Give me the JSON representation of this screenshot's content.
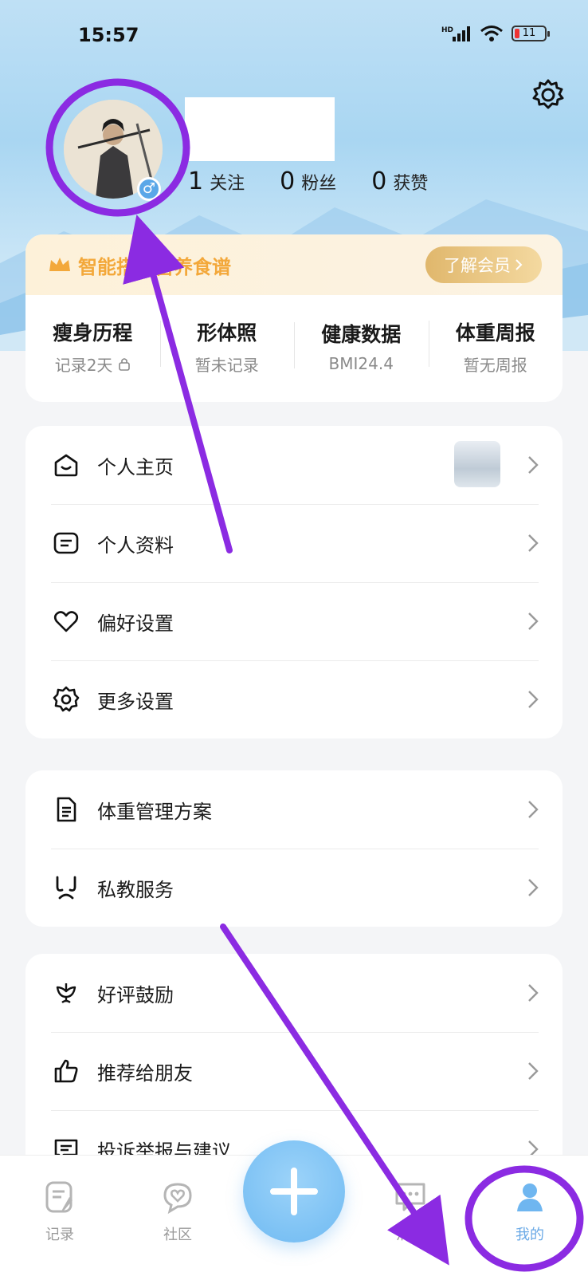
{
  "status_bar": {
    "time": "15:57",
    "network": "HD",
    "battery": "11"
  },
  "profile": {
    "stats": [
      {
        "num": "1",
        "label": "关注"
      },
      {
        "num": "0",
        "label": "粉丝"
      },
      {
        "num": "0",
        "label": "获赞"
      }
    ],
    "gender_symbol": "♂"
  },
  "vip": {
    "text": "智能搭配营养食谱",
    "button": "了解会员"
  },
  "metrics": [
    {
      "title": "瘦身历程",
      "sub": "记录2天"
    },
    {
      "title": "形体照",
      "sub": "暂未记录"
    },
    {
      "title": "健康数据",
      "sub": "BMI24.4"
    },
    {
      "title": "体重周报",
      "sub": "暂无周报"
    }
  ],
  "menu1": [
    {
      "label": "个人主页"
    },
    {
      "label": "个人资料"
    },
    {
      "label": "偏好设置"
    },
    {
      "label": "更多设置"
    }
  ],
  "menu2": [
    {
      "label": "体重管理方案"
    },
    {
      "label": "私教服务"
    }
  ],
  "menu3": [
    {
      "label": "好评鼓励"
    },
    {
      "label": "推荐给朋友"
    },
    {
      "label": "投诉举报与建议"
    }
  ],
  "tabs": [
    {
      "label": "记录"
    },
    {
      "label": "社区"
    },
    {
      "label": "消息"
    },
    {
      "label": "我的"
    }
  ],
  "colors": {
    "accent": "#6fbaf2",
    "vip_text": "#f3a83a",
    "annotation": "#8b2be2"
  }
}
